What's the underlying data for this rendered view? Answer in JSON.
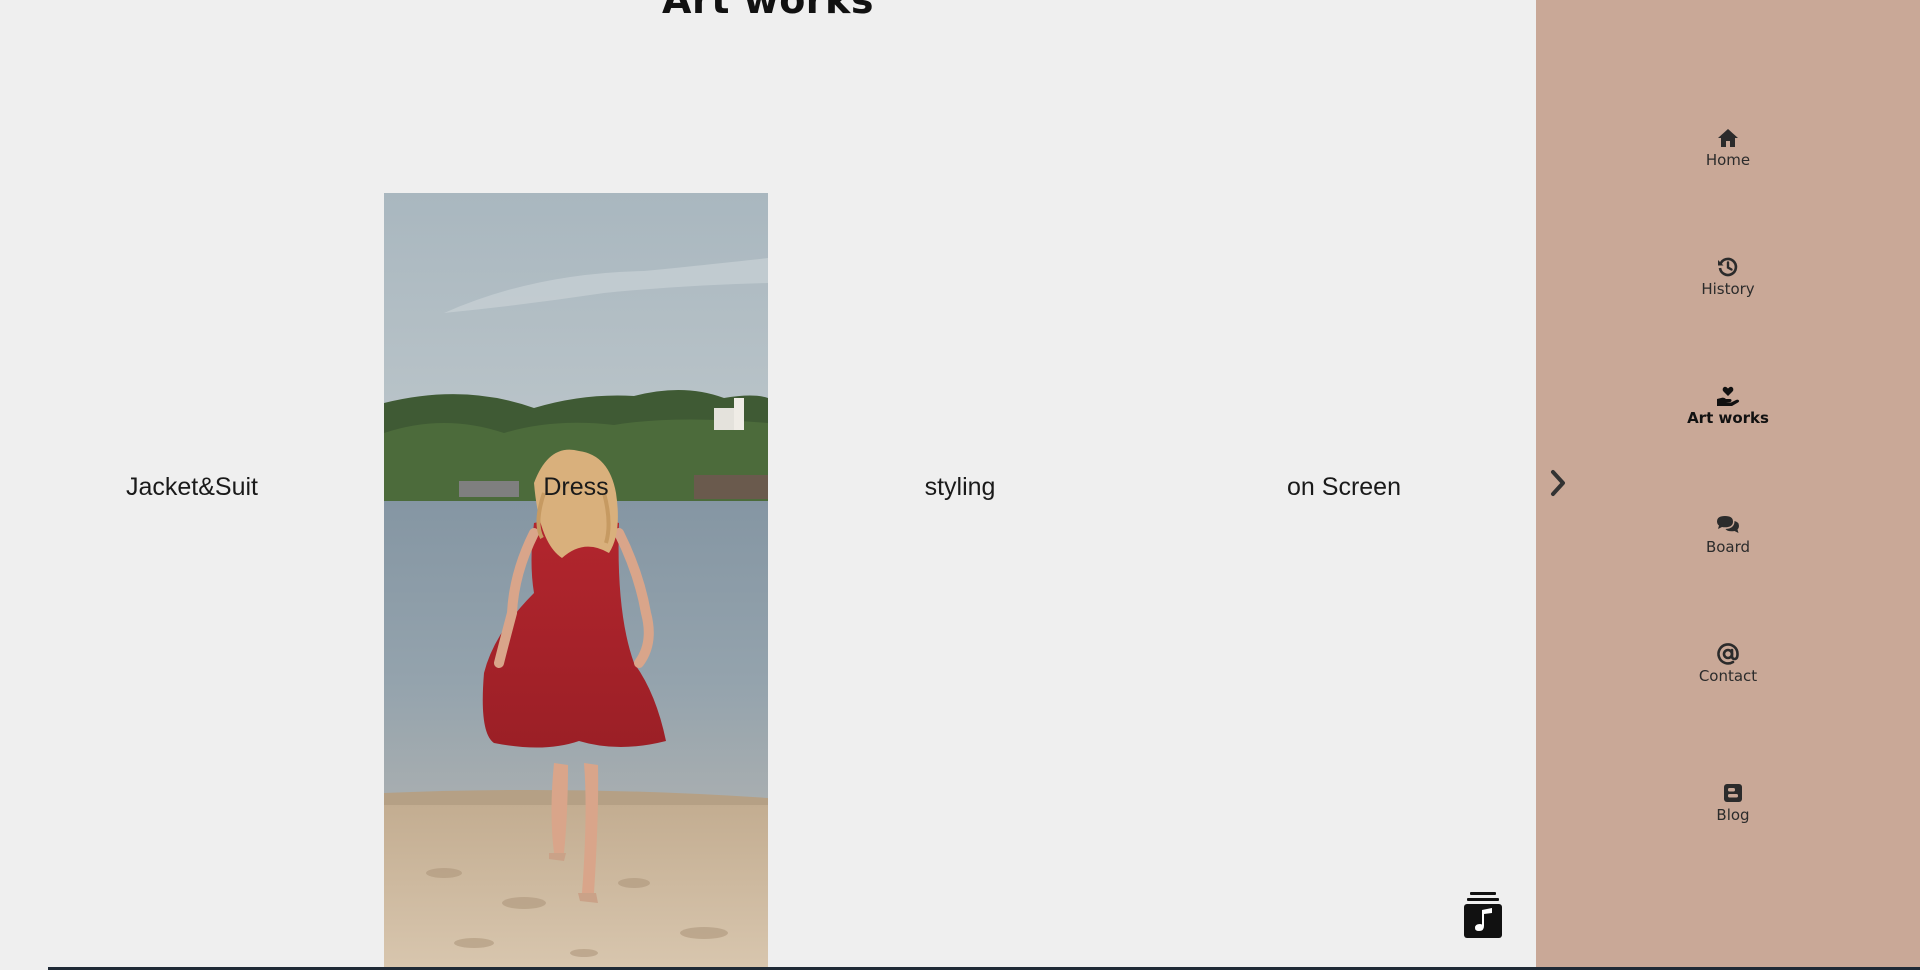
{
  "page": {
    "title": "Art works"
  },
  "gallery": {
    "items": [
      {
        "label": "Jacket&Suit"
      },
      {
        "label": "Dress"
      },
      {
        "label": "styling"
      },
      {
        "label": "on Screen"
      }
    ]
  },
  "sidebar": {
    "items": [
      {
        "label": "Home",
        "icon": "home-icon"
      },
      {
        "label": "History",
        "icon": "history-icon"
      },
      {
        "label": "Art works",
        "icon": "hand-holding-heart-icon",
        "active": true
      },
      {
        "label": "Board",
        "icon": "comments-icon"
      },
      {
        "label": "Contact",
        "icon": "at-icon"
      },
      {
        "label": "Blog",
        "icon": "blogger-icon"
      }
    ]
  },
  "colors": {
    "background": "#efefef",
    "sidebar": "#c9a897",
    "text": "#2b2b2b"
  },
  "controls": {
    "next_icon": "chevron-right-icon",
    "music_icon": "music-playlist-icon"
  }
}
